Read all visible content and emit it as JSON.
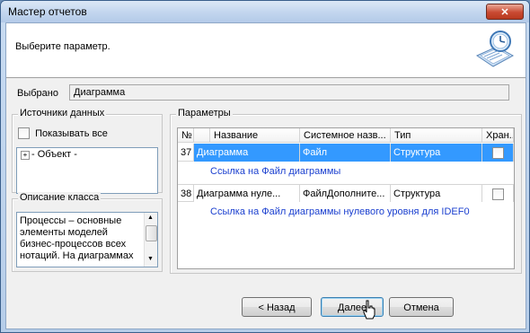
{
  "window": {
    "title": "Мастер отчетов",
    "close_glyph": "✕"
  },
  "header": {
    "prompt": "Выберите параметр.",
    "icon": "report-wizard-icon"
  },
  "selected": {
    "label": "Выбрано",
    "value": "Диаграмма"
  },
  "sources": {
    "title": "Источники данных",
    "show_all_label": "Показывать все",
    "show_all_checked": false,
    "tree_expander": "+",
    "tree_item": "- Объект -"
  },
  "description": {
    "title": "Описание класса",
    "text": "Процессы – основные элементы моделей бизнес-процессов всех нотаций. На диаграммах"
  },
  "params": {
    "title": "Параметры",
    "columns": [
      "№",
      "Название",
      "Системное назв...",
      "Тип",
      "Хран..."
    ],
    "rows": [
      {
        "num": "37",
        "name": "Диаграмма",
        "sys": "Файл",
        "type": "Структура",
        "stored": false,
        "link": "Ссылка на Файл диаграммы",
        "selected": true
      },
      {
        "num": "38",
        "name": "Диаграмма нуле...",
        "sys": "ФайлДополните...",
        "type": "Структура",
        "stored": false,
        "link": "Ссылка на Файл диаграммы нулевого уровня для IDEF0",
        "selected": false
      }
    ],
    "row_pointer": "▸"
  },
  "buttons": {
    "back": "< Назад",
    "next": "Далее",
    "cancel": "Отмена"
  }
}
